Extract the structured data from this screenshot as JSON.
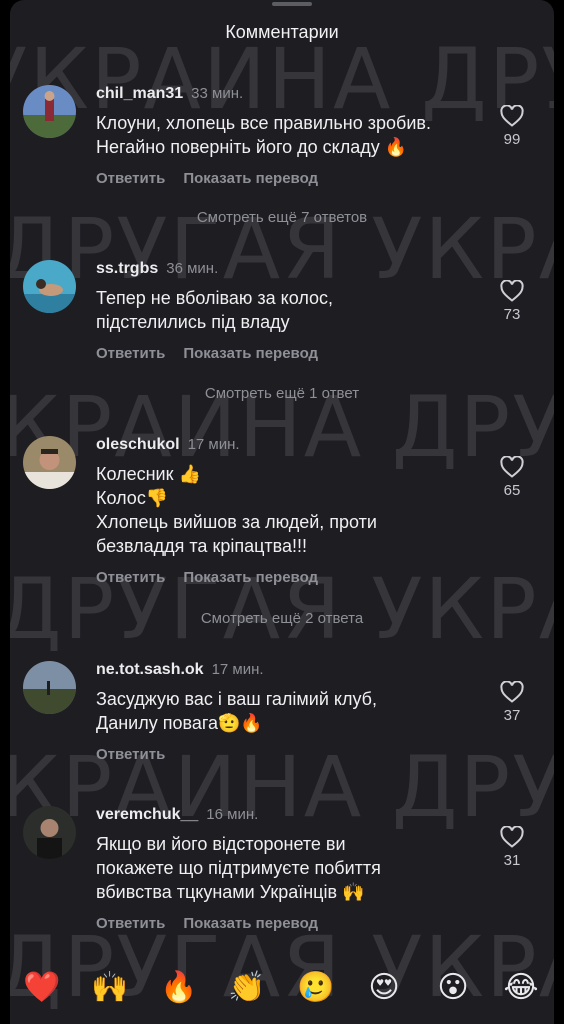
{
  "header": {
    "title": "Комментарии"
  },
  "watermark": [
    "УКРАИНА  ДРУГАЯ",
    "ДРУГАЯ УКРАИНА",
    "КРАИНА  ДРУГАЯ",
    "ДРУГАЯ УКРАИНА",
    "КРАИНА  ДРУГАЯ",
    "ДРУГАЯ УКРАИНА"
  ],
  "actions": {
    "reply": "Ответить",
    "translate": "Показать перевод"
  },
  "comments": [
    {
      "user": "chil_man31",
      "time": "33 мин.",
      "text": "Клоуни, хлопець все правильно зробив.\nНегайно поверніть його до складу 🔥",
      "likes": "99",
      "more_replies": "Смотреть ещё 7 ответов"
    },
    {
      "user": "ss.trgbs",
      "time": "36 мин.",
      "text": "Тепер не вболіваю за колос,\nпідстелились під владу",
      "likes": "73",
      "more_replies": "Смотреть ещё 1 ответ"
    },
    {
      "user": "oleschukol",
      "time": "17 мин.",
      "text": "Колесник 👍\nКолос👎\nХлопець вийшов за людей, проти\nбезвладдя та кріпацтва!!!",
      "likes": "65",
      "more_replies": "Смотреть ещё 2 ответа"
    },
    {
      "user": "ne.tot.sash.ok",
      "time": "17 мин.",
      "text": "Засуджую вас і ваш галімий клуб,\nДанилу повага🫡🔥",
      "likes": "37"
    },
    {
      "user": "veremchuk__",
      "time": "16 мин.",
      "text": "Якщо ви його відсторонете ви\nпокажете що підтримуєте побиття\nвбивства тцкунами Українців 🙌",
      "likes": "31"
    }
  ],
  "quick_reactions": [
    "❤️",
    "🙌",
    "🔥",
    "👏",
    "🥲",
    "😍",
    "😮",
    "😂"
  ],
  "colors": {
    "background": "#1d1d22",
    "text": "#f0f0f2",
    "muted": "#8f8f97"
  }
}
